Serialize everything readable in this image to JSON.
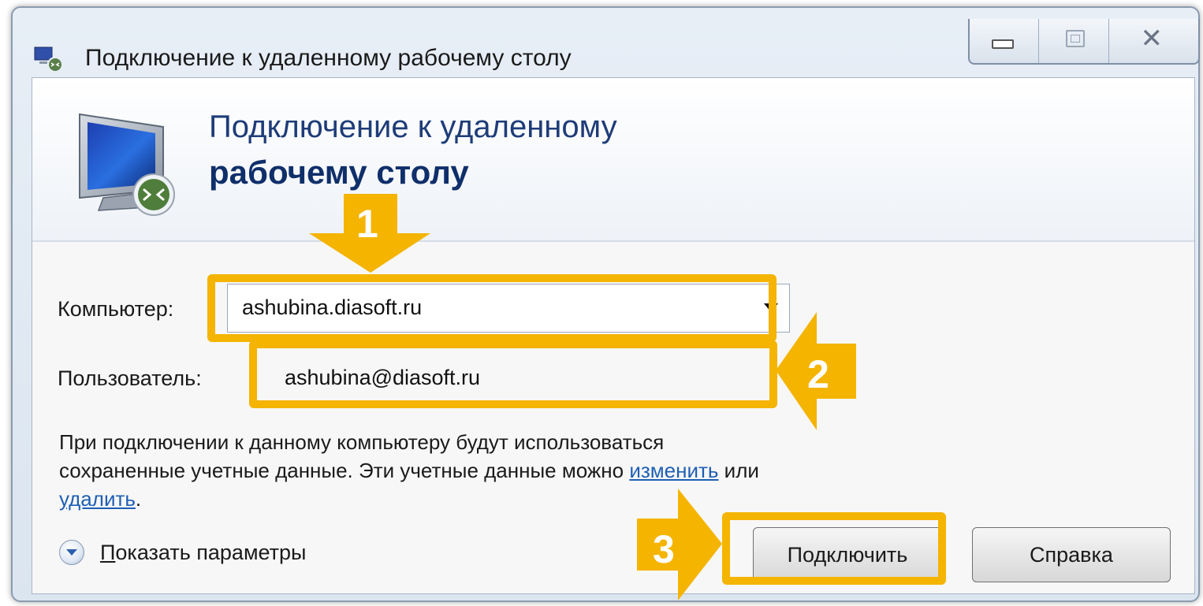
{
  "window": {
    "title": "Подключение к удаленному рабочему столу",
    "controls": [
      "minimize",
      "maximize",
      "close"
    ]
  },
  "banner": {
    "line1": "Подключение к удаленному",
    "line2": "рабочему столу"
  },
  "form": {
    "computer_label": "Компьютер:",
    "computer_value": "ashubina.diasoft.ru",
    "user_label": "Пользователь:",
    "user_value": "ashubina@diasoft.ru"
  },
  "info": {
    "text_before": "При подключении к данному компьютеру будут использоваться сохраненные учетные данные.  Эти учетные данные можно ",
    "link_change": "изменить",
    "text_mid": " или ",
    "link_delete": "удалить",
    "text_after": "."
  },
  "options": {
    "label_first_letter": "П",
    "label_rest": "оказать параметры"
  },
  "buttons": {
    "connect": "Подключить",
    "help": "Справка"
  },
  "annotations": {
    "step1": "1",
    "step2": "2",
    "step3": "3",
    "color": "#f4b400"
  },
  "colors": {
    "banner_title": "#1e3c78",
    "link": "#1f5fb5"
  }
}
